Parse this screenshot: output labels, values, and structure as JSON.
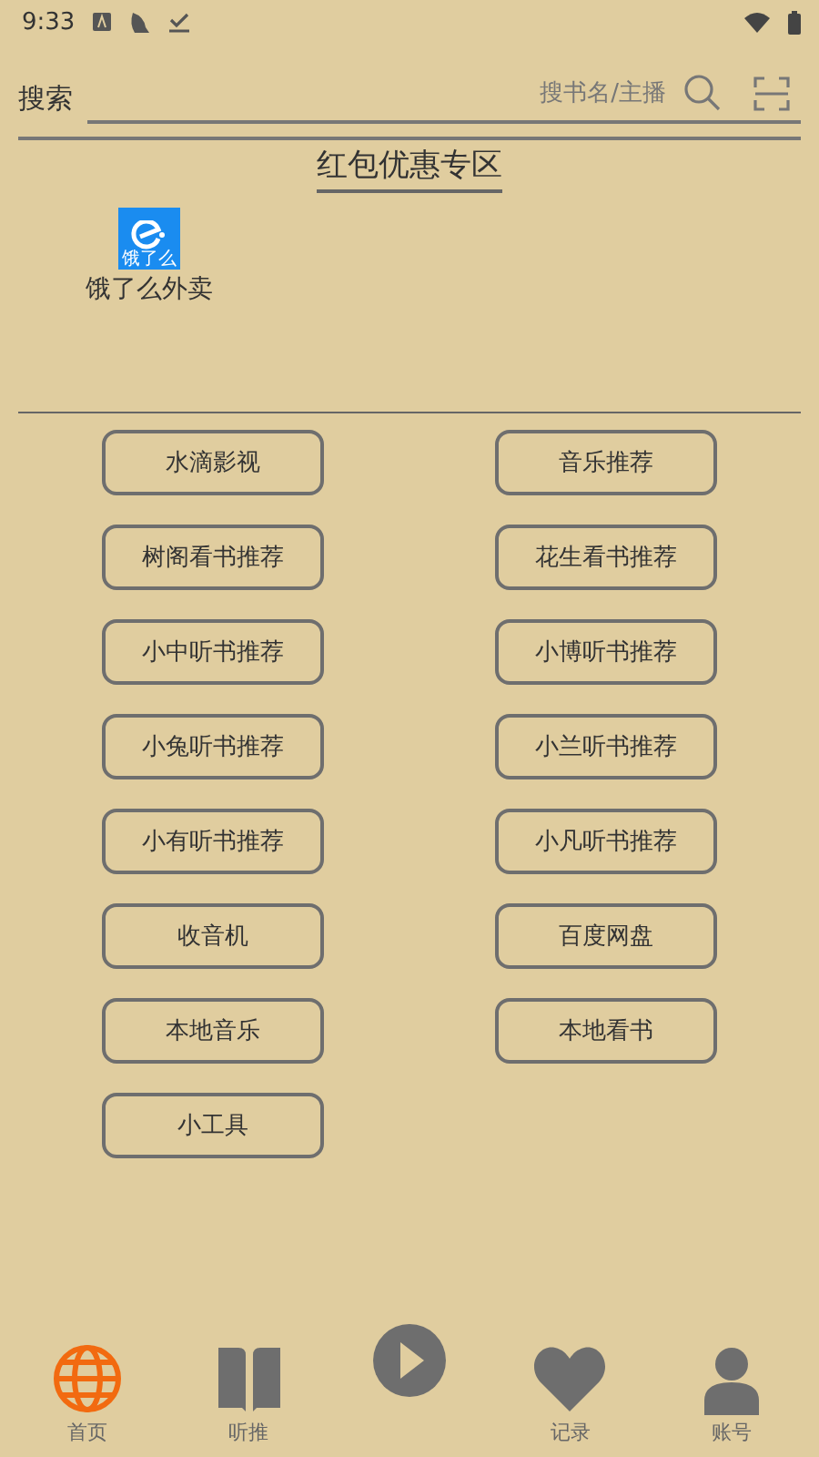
{
  "status_bar": {
    "time": "9:33"
  },
  "search": {
    "label": "搜索",
    "placeholder": "搜书名/主播"
  },
  "promo": {
    "title": "红包优惠专区",
    "apps": [
      {
        "label": "饿了么外卖",
        "logo_text": "饿了么"
      }
    ]
  },
  "buttons": [
    "水滴影视",
    "音乐推荐",
    "树阁看书推荐",
    "花生看书推荐",
    "小中听书推荐",
    "小博听书推荐",
    "小兔听书推荐",
    "小兰听书推荐",
    "小有听书推荐",
    "小凡听书推荐",
    "收音机",
    "百度网盘",
    "本地音乐",
    "本地看书",
    "小工具"
  ],
  "nav": [
    {
      "kind": "globe",
      "label": "首页",
      "selected": true
    },
    {
      "kind": "book",
      "label": "听推",
      "selected": false
    },
    {
      "kind": "play",
      "selected": false
    },
    {
      "kind": "heart",
      "label": "记录",
      "selected": false
    },
    {
      "kind": "person",
      "label": "账号",
      "selected": false
    }
  ]
}
